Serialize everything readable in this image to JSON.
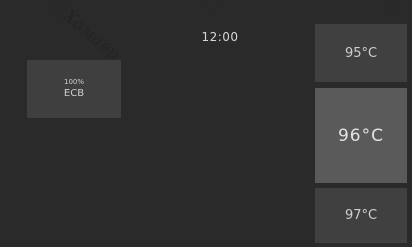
{
  "clock": {
    "time": "12:00"
  },
  "battery": {
    "percent": "100%",
    "label": "ECB"
  },
  "temperature": {
    "up_option": "95°C",
    "current": "96°C",
    "down_option": "97°C"
  },
  "watermark": "Хомаер"
}
